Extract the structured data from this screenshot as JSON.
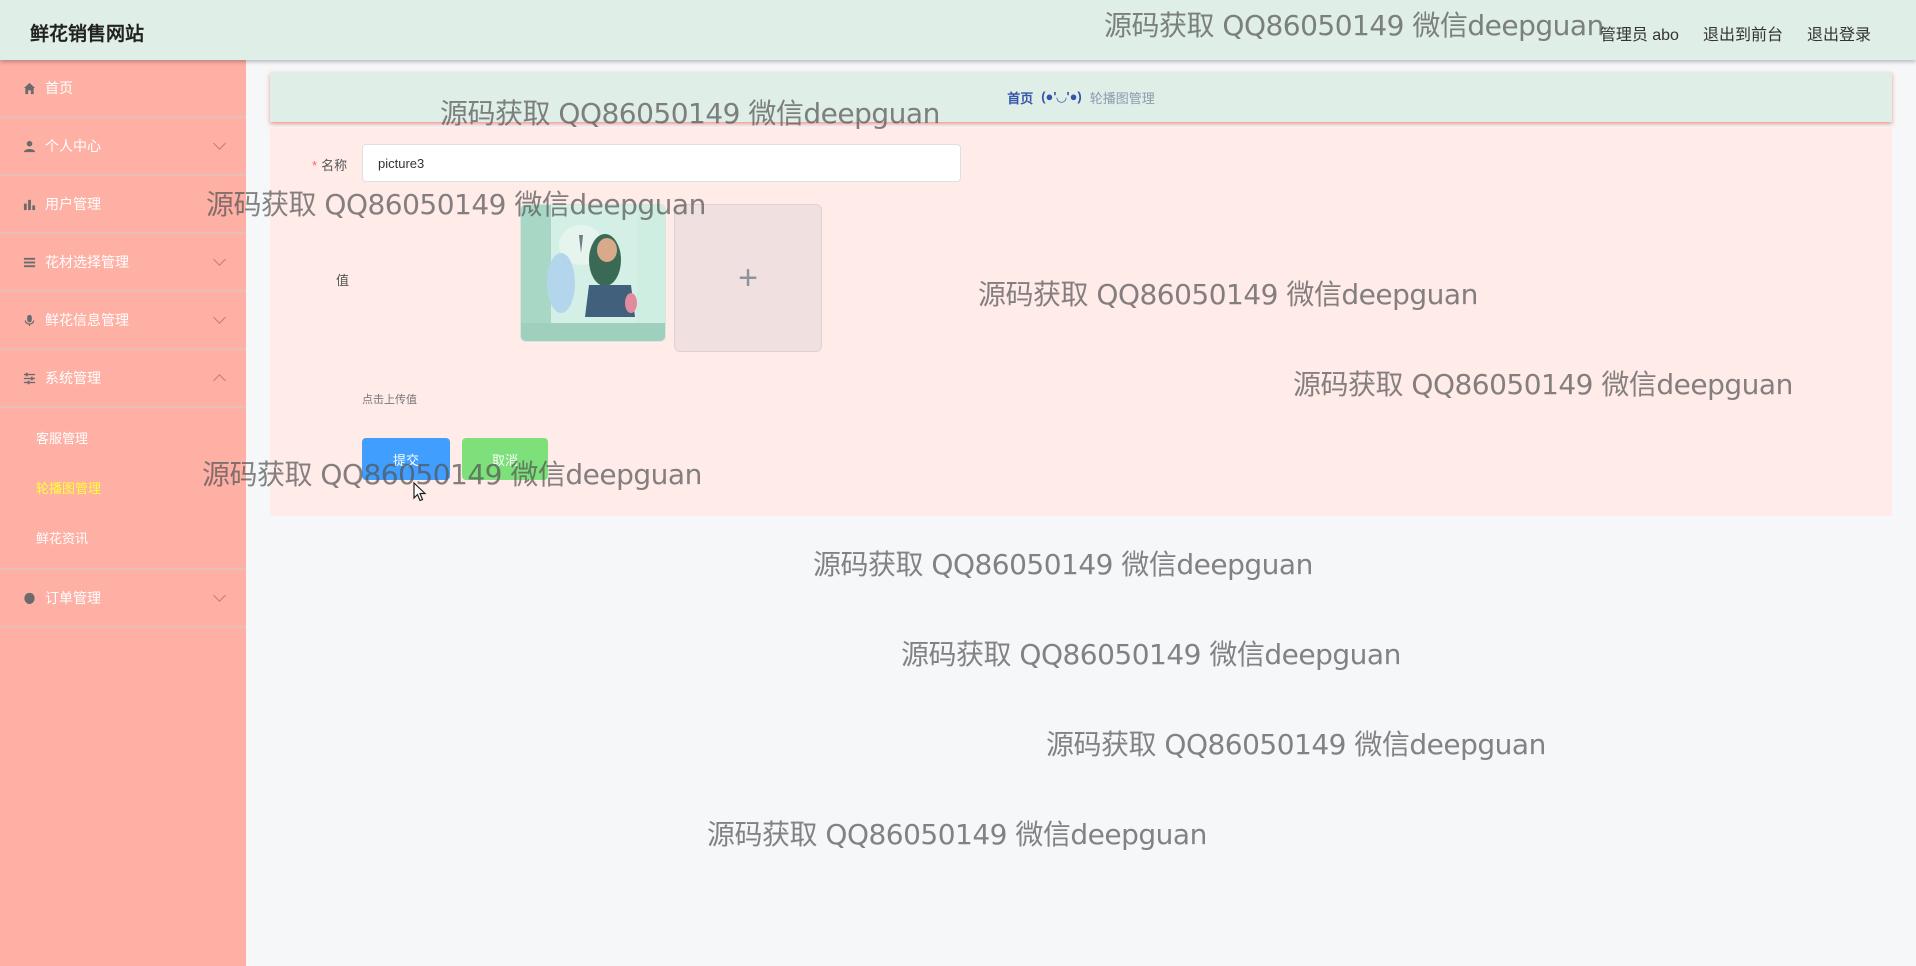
{
  "header": {
    "brand": "鲜花销售网站",
    "admin_label": "管理员 abo",
    "front_link": "退出到前台",
    "logout_link": "退出登录"
  },
  "sidebar": {
    "items": [
      {
        "label": "首页",
        "icon": "home-icon"
      },
      {
        "label": "个人中心",
        "icon": "user-icon"
      },
      {
        "label": "用户管理",
        "icon": "bar-chart-icon"
      },
      {
        "label": "花材选择管理",
        "icon": "list-icon"
      },
      {
        "label": "鲜花信息管理",
        "icon": "mic-icon"
      },
      {
        "label": "系统管理",
        "icon": "sliders-icon"
      },
      {
        "label": "订单管理",
        "icon": "shield-icon"
      }
    ],
    "system_sub": [
      "客服管理",
      "轮播图管理",
      "鲜花资讯"
    ]
  },
  "breadcrumb": {
    "home": "首页",
    "separator": "(●'◡'●)",
    "current": "轮播图管理"
  },
  "form": {
    "name_label": "名称",
    "name_value": "picture3",
    "value_label": "值",
    "upload_hint": "点击上传值",
    "submit_label": "提交",
    "cancel_label": "取消"
  },
  "watermark": "源码获取 QQ86050149 微信deepguan",
  "colors": {
    "header_bg": "#dfeee6",
    "sidebar_bg": "#ffb0a5",
    "panel_bg": "#ffece8",
    "active_sub": "#ffff33",
    "submit": "#409eff",
    "cancel": "#7de07a"
  }
}
